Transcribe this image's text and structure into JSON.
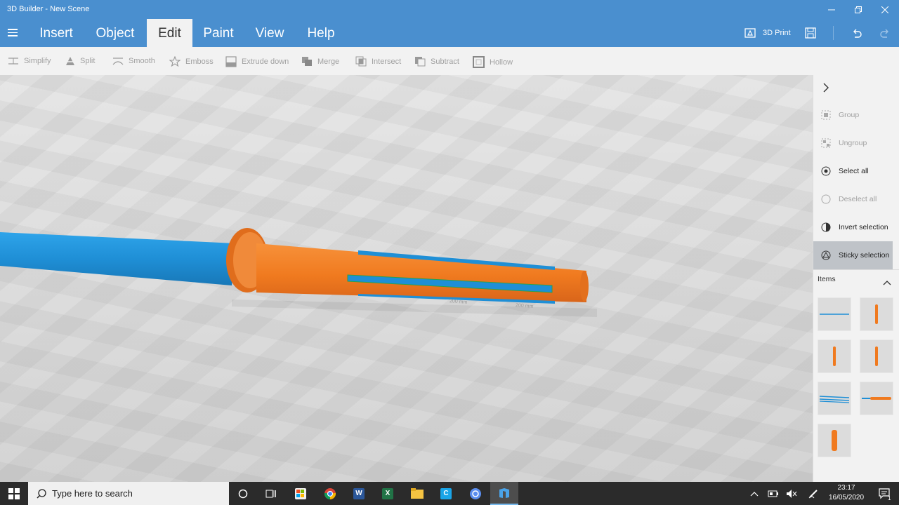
{
  "window": {
    "title": "3D Builder - New Scene"
  },
  "ribbon": {
    "tabs": [
      {
        "label": "Insert"
      },
      {
        "label": "Object"
      },
      {
        "label": "Edit"
      },
      {
        "label": "Paint"
      },
      {
        "label": "View"
      },
      {
        "label": "Help"
      }
    ],
    "active_tab": "Edit",
    "print_label": "3D Print"
  },
  "toolbar": {
    "tools": [
      {
        "label": "Simplify",
        "icon": "simplify-icon"
      },
      {
        "label": "Split",
        "icon": "split-icon"
      },
      {
        "label": "Smooth",
        "icon": "smooth-icon"
      },
      {
        "label": "Emboss",
        "icon": "star-icon"
      },
      {
        "label": "Extrude down",
        "icon": "extrude-down-icon"
      },
      {
        "label": "Merge",
        "icon": "merge-icon"
      },
      {
        "label": "Intersect",
        "icon": "intersect-icon"
      },
      {
        "label": "Subtract",
        "icon": "subtract-icon"
      },
      {
        "label": "Hollow",
        "icon": "hollow-icon"
      }
    ]
  },
  "side_panel": {
    "actions": [
      {
        "label": "Group",
        "enabled": false
      },
      {
        "label": "Ungroup",
        "enabled": false
      },
      {
        "label": "Select all",
        "enabled": true
      },
      {
        "label": "Deselect all",
        "enabled": false
      },
      {
        "label": "Invert selection",
        "enabled": true
      },
      {
        "label": "Sticky selection",
        "enabled": true,
        "selected": true
      }
    ],
    "items_label": "Items"
  },
  "viewport": {
    "measure_labels": [
      "200 mm",
      "200 mm"
    ],
    "colors": {
      "blue": "#1f8fd6",
      "orange": "#f07a1f",
      "floor": "#dedede"
    }
  },
  "taskbar": {
    "search_placeholder": "Type here to search",
    "time": "23:17",
    "date": "16/05/2020",
    "notification_count": "1"
  },
  "colors": {
    "accent": "#4a8fcf",
    "toolbar_bg": "#f2f2f2",
    "taskbar_bg": "#2b2b2b"
  }
}
